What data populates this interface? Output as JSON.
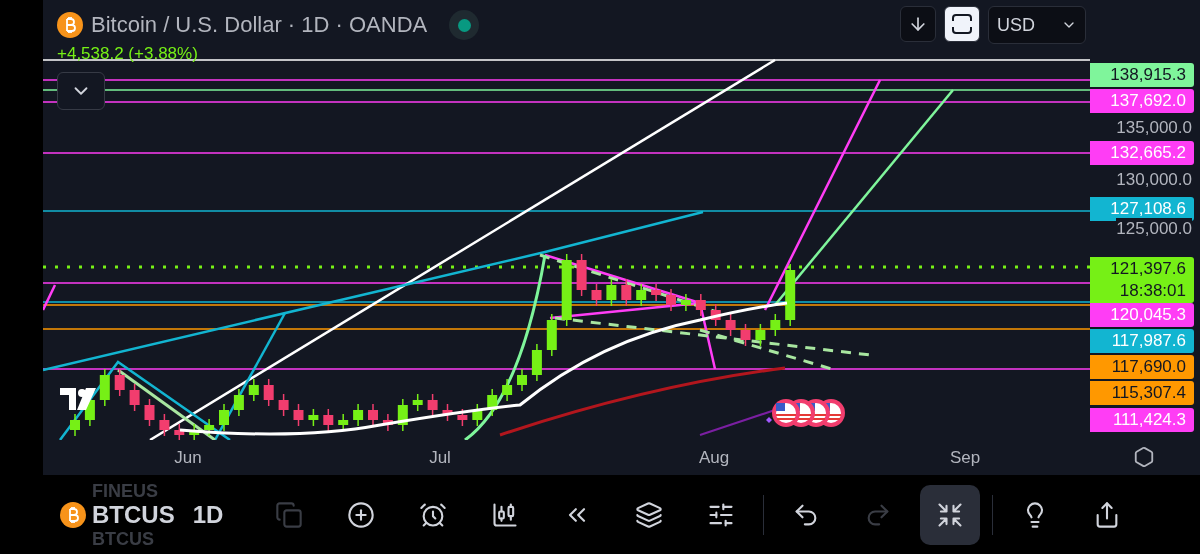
{
  "header": {
    "title": "Bitcoin / U.S. Dollar · 1D · OANDA",
    "market_open": true,
    "change": "+4,538.2 (+3.88%)"
  },
  "top_controls": {
    "currency": "USD"
  },
  "price_axis": [
    {
      "kind": "tag",
      "label": "138,915.3",
      "color": "#7ff59b"
    },
    {
      "kind": "tag",
      "label": "137,692.0",
      "color": "#ff3df5"
    },
    {
      "kind": "tick",
      "label": "135,000.0"
    },
    {
      "kind": "tag",
      "label": "132,665.2",
      "color": "#ff3df5"
    },
    {
      "kind": "tick",
      "label": "130,000.0"
    },
    {
      "kind": "tag",
      "label": "127,108.6",
      "color": "#12b5d1"
    },
    {
      "kind": "tick",
      "label": "125,000.0"
    },
    {
      "kind": "last",
      "label": "121,397.6",
      "countdown": "18:38:01",
      "color": "#76f016"
    },
    {
      "kind": "tag",
      "label": "120,045.3",
      "color": "#ff3df5"
    },
    {
      "kind": "tag",
      "label": "117,987.6",
      "color": "#12b5d1"
    },
    {
      "kind": "tag",
      "label": "117,690.0",
      "color": "#ff9800"
    },
    {
      "kind": "tag",
      "label": "115,307.4",
      "color": "#ff9800"
    },
    {
      "kind": "tag",
      "label": "111,424.3",
      "color": "#ff3df5"
    }
  ],
  "time_axis": [
    "Jun",
    "Jul",
    "Aug",
    "Sep"
  ],
  "toolbar": {
    "symbols": [
      {
        "label": "FINEUS",
        "selected": false
      },
      {
        "label": "BTCUS",
        "selected": true
      },
      {
        "label": "BTCUS",
        "selected": false
      }
    ],
    "interval": "1D",
    "tool_groups": [
      [
        {
          "selected": false,
          "disabled": true
        },
        {
          "selected": false,
          "disabled": false
        },
        {
          "selected": false,
          "disabled": false
        },
        {
          "selected": false,
          "disabled": false
        },
        {
          "selected": false,
          "disabled": false
        },
        {
          "selected": false,
          "disabled": false
        },
        {
          "selected": false,
          "disabled": false
        }
      ],
      [
        {
          "selected": false,
          "disabled": false
        },
        {
          "selected": false,
          "disabled": true
        },
        {
          "selected": true,
          "disabled": false
        }
      ],
      [
        {
          "selected": false,
          "disabled": false
        },
        {
          "selected": false,
          "disabled": false
        }
      ]
    ]
  }
}
